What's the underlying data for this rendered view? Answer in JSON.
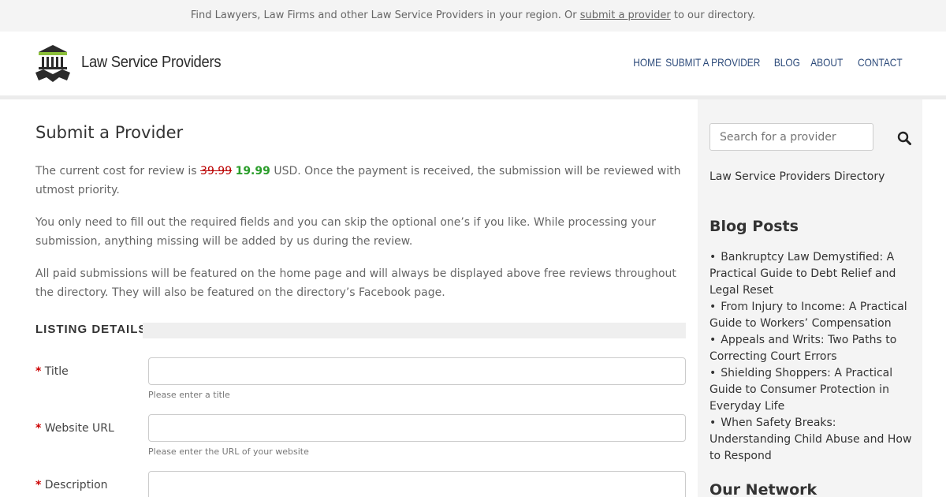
{
  "topbar": {
    "text_before": "Find Lawyers, Law Firms and other Law Service Providers in your region. Or ",
    "link": "submit a provider",
    "text_after": " to our directory."
  },
  "header": {
    "site_name": "Law Service Providers",
    "nav": [
      "HOME",
      "SUBMIT A PROVIDER",
      "BLOG",
      "ABOUT",
      "CONTACT"
    ]
  },
  "main": {
    "title": "Submit a Provider",
    "p1_before": "The current cost for review is ",
    "old_price": "39.99",
    "new_price": "19.99",
    "p1_after": " USD. Once the payment is received, the submission will be reviewed with utmost priority.",
    "p2": "You only need to fill out the required fields and you can skip the optional one’s if you like. While processing your submission, anything missing will be added by us during the review.",
    "p3": "All paid submissions will be featured on the home page and will always be displayed above free reviews throughout the directory. They will also be featured on the directory’s Facebook page.",
    "section_title": "LISTING DETAILS",
    "fields": [
      {
        "label": "Title",
        "hint": "Please enter a title",
        "value": ""
      },
      {
        "label": "Website URL",
        "hint": "Please enter the URL of your website",
        "value": ""
      },
      {
        "label": "Description",
        "hint": "",
        "value": ""
      }
    ],
    "required_mark": "*"
  },
  "sidebar": {
    "search_placeholder": "Search for a provider",
    "directory_link": "Law Service Providers Directory",
    "blog_title": "Blog Posts",
    "posts": [
      "Bankruptcy Law Demystified: A Practical Guide to Debt Relief and Legal Reset",
      "From Injury to Income: A Practical Guide to Workers’ Compensation",
      "Appeals and Writs: Two Paths to Correcting Court Errors",
      "Shielding Shoppers: A Practical Guide to Consumer Protection in Everyday Life",
      "When Safety Breaks: Understanding Child Abuse and How to Respond"
    ],
    "network_title": "Our Network"
  },
  "colors": {
    "nav": "#2c4a7a",
    "old_price": "#bb0000",
    "new_price": "#2a9d2a",
    "required": "#cc0000",
    "logo_green": "#8bbf3a"
  },
  "icons": {
    "logo": "courthouse-handshake-icon",
    "search": "magnifier-icon"
  }
}
